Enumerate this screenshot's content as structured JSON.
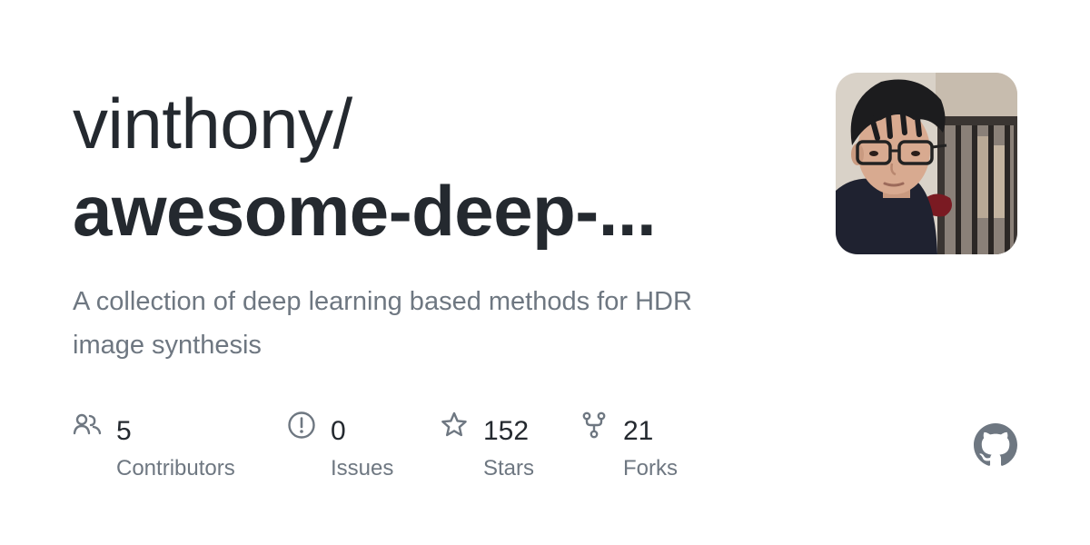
{
  "repo": {
    "owner": "vinthony/",
    "name": "awesome-deep-...",
    "description": "A collection of deep learning based methods for HDR image synthesis"
  },
  "stats": [
    {
      "icon": "people-icon",
      "value": "5",
      "label": "Contributors"
    },
    {
      "icon": "issue-icon",
      "value": "0",
      "label": "Issues"
    },
    {
      "icon": "star-icon",
      "value": "152",
      "label": "Stars"
    },
    {
      "icon": "fork-icon",
      "value": "21",
      "label": "Forks"
    }
  ],
  "colors": {
    "text_primary": "#24292f",
    "text_secondary": "#6e7781",
    "icon": "#6e7781",
    "logo": "#6e7781"
  }
}
